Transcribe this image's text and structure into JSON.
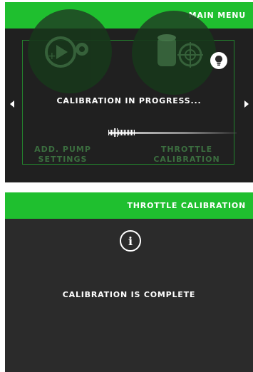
{
  "screen_top": {
    "title": "MAIN MENU",
    "status_text": "CALIBRATION IN PROGRESS...",
    "tiles": [
      {
        "label_line1": "ADD. PUMP",
        "label_line2": "SETTINGS",
        "icon": "pump-gear-icon"
      },
      {
        "label_line1": "THROTTLE",
        "label_line2": "CALIBRATION",
        "icon": "throttle-target-icon"
      }
    ],
    "hint_icon": "lightbulb-icon",
    "progress": 0.4
  },
  "screen_bottom": {
    "title": "THROTTLE CALIBRATION",
    "icon": "info-icon",
    "message": "CALIBRATION IS COMPLETE"
  },
  "colors": {
    "brand_green": "#1fbf2f",
    "screen_bg": "#2b2b2b"
  }
}
